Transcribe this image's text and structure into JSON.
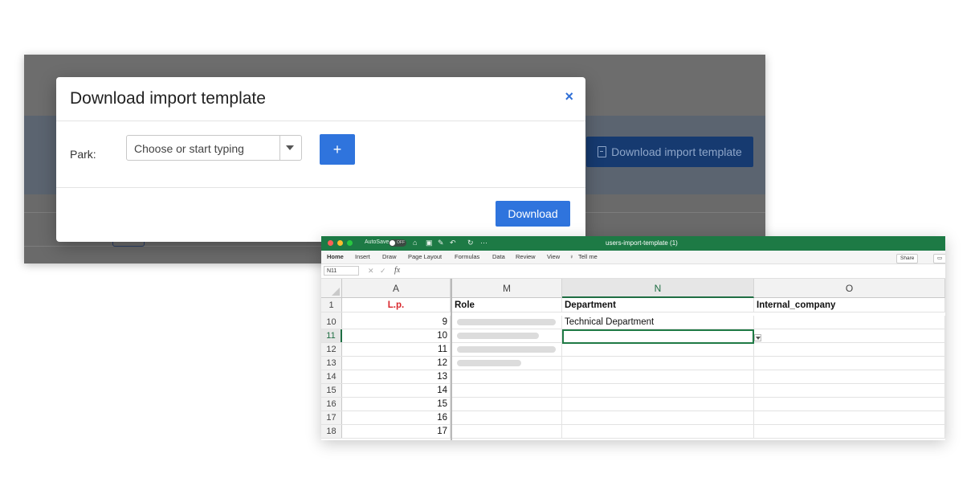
{
  "background_app": {
    "download_template_button": "Download import template"
  },
  "modal": {
    "title": "Download import template",
    "close_icon": "×",
    "park_label": "Park:",
    "park_placeholder": "Choose or start typing",
    "add_button": "+",
    "download_button": "Download"
  },
  "excel": {
    "titlebar": {
      "autosave": "AutoSave",
      "autosave_state": "OFF",
      "filename": "users-import-template (1)",
      "window_dots": [
        "#ff5f57",
        "#febc2e",
        "#28c840"
      ]
    },
    "ribbon_tabs": [
      "Home",
      "Insert",
      "Draw",
      "Page Layout",
      "Formulas",
      "Data",
      "Review",
      "View",
      "Tell me"
    ],
    "share_label": "Share",
    "name_box": "N11",
    "fx_label": "fx",
    "columns": [
      "A",
      "M",
      "N",
      "O"
    ],
    "header_row": {
      "row": "1",
      "a": "L.p.",
      "m": "Role",
      "n": "Department",
      "o": "Internal_company"
    },
    "rows": [
      {
        "row": "10",
        "a": "9",
        "n": "Technical Department"
      },
      {
        "row": "11",
        "a": "10",
        "n": ""
      },
      {
        "row": "12",
        "a": "11",
        "n": ""
      },
      {
        "row": "13",
        "a": "12",
        "n": ""
      },
      {
        "row": "14",
        "a": "13",
        "n": ""
      },
      {
        "row": "15",
        "a": "14",
        "n": ""
      },
      {
        "row": "16",
        "a": "15",
        "n": ""
      },
      {
        "row": "17",
        "a": "16",
        "n": ""
      },
      {
        "row": "18",
        "a": "17",
        "n": ""
      }
    ],
    "accent_color": "#1d7a45"
  }
}
